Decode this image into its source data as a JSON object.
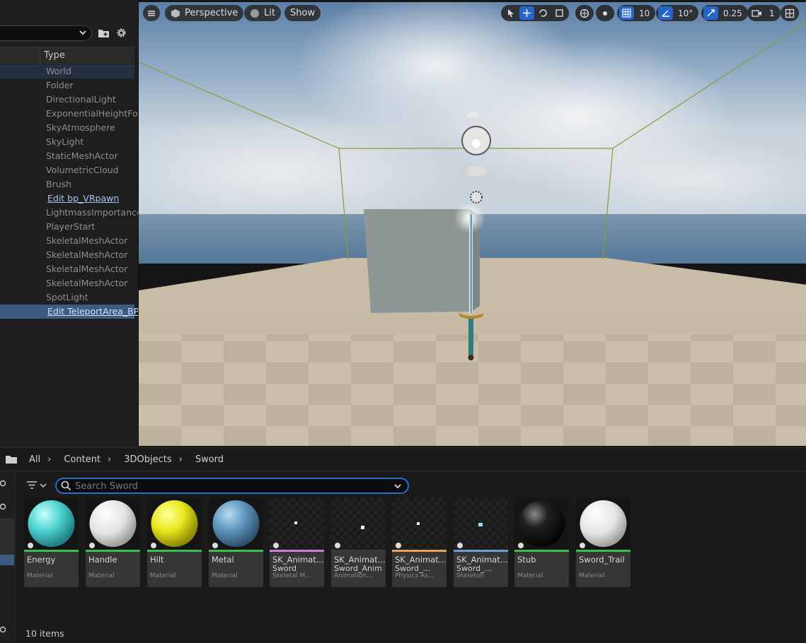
{
  "outliner": {
    "type_header": "Type",
    "rows": [
      {
        "type": "World"
      },
      {
        "type": "Folder"
      },
      {
        "type": "DirectionalLight"
      },
      {
        "type": "ExponentialHeightFog"
      },
      {
        "type": "SkyAtmosphere"
      },
      {
        "type": "SkyLight"
      },
      {
        "type": "StaticMeshActor"
      },
      {
        "type": "VolumetricCloud"
      },
      {
        "type": "Brush"
      },
      {
        "type": "Edit bp_VRpawn"
      },
      {
        "type": "LightmassImportance"
      },
      {
        "type": "PlayerStart"
      },
      {
        "type": "SkeletalMeshActor"
      },
      {
        "type": "SkeletalMeshActor"
      },
      {
        "type": "SkeletalMeshActor"
      },
      {
        "type": "SkeletalMeshActor"
      },
      {
        "type": "SpotLight"
      },
      {
        "type": "Edit TeleportArea_BP"
      }
    ]
  },
  "viewport": {
    "perspective_label": "Perspective",
    "lit_label": "Lit",
    "show_label": "Show",
    "grid_snap": "10",
    "rotation_snap": "10°",
    "scale_snap": "0.25",
    "camera_speed": "1"
  },
  "content_browser": {
    "breadcrumb": [
      "All",
      "Content",
      "3DObjects",
      "Sword"
    ],
    "search_placeholder": "Search Sword",
    "item_count": "10 items",
    "assets": [
      {
        "name": "Energy",
        "name2": "",
        "kind": "Material",
        "strip": "#3bbf4a"
      },
      {
        "name": "Handle",
        "name2": "",
        "kind": "Material",
        "strip": "#3bbf4a"
      },
      {
        "name": "Hilt",
        "name2": "",
        "kind": "Material",
        "strip": "#3bbf4a"
      },
      {
        "name": "Metal",
        "name2": "",
        "kind": "Material",
        "strip": "#3bbf4a"
      },
      {
        "name": "SK_Animat...",
        "name2": "Sword",
        "kind": "Skeletal M...",
        "strip": "#d07be0"
      },
      {
        "name": "SK_Animat...",
        "name2": "Sword_Anim",
        "kind": "Animation...",
        "strip": "#3a3a3a"
      },
      {
        "name": "SK_Animat...",
        "name2": "Sword_...",
        "kind": "Physics As...",
        "strip": "#e8a25a"
      },
      {
        "name": "SK_Animat...",
        "name2": "Sword_...",
        "kind": "Skeleton",
        "strip": "#6aa2d8"
      },
      {
        "name": "Stub",
        "name2": "",
        "kind": "Material",
        "strip": "#3bbf4a"
      },
      {
        "name": "Sword_Trail",
        "name2": "",
        "kind": "Material",
        "strip": "#3bbf4a"
      }
    ]
  }
}
